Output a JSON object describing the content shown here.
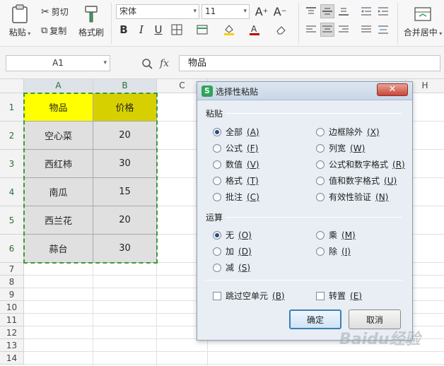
{
  "ribbon": {
    "paste_label": "粘贴",
    "cut_label": "剪切",
    "copy_label": "复制",
    "format_painter_label": "格式刷",
    "font_name": "宋体",
    "font_size": "11",
    "merge_center_label": "合并居中",
    "font_color": "#c00000",
    "fill_color": "#ffcc00"
  },
  "formula_bar": {
    "name_box": "A1",
    "fx_label": "fx",
    "content": "物品"
  },
  "sheet": {
    "columns": [
      "A",
      "B",
      "C",
      "",
      "",
      "",
      "",
      "H"
    ],
    "rows": [
      "1",
      "2",
      "3",
      "4",
      "5",
      "6",
      "7",
      "8",
      "9",
      "10",
      "11",
      "12",
      "13",
      "14"
    ],
    "data": [
      [
        "物品",
        "价格"
      ],
      [
        "空心菜",
        "20"
      ],
      [
        "西红柿",
        "30"
      ],
      [
        "南瓜",
        "15"
      ],
      [
        "西兰花",
        "20"
      ],
      [
        "蒜台",
        "30"
      ]
    ]
  },
  "dialog": {
    "title": "选择性粘贴",
    "paste_group": "粘贴",
    "paste_options": [
      {
        "label": "全部",
        "key": "(A)",
        "selected": true
      },
      {
        "label": "公式",
        "key": "(F)",
        "selected": false
      },
      {
        "label": "数值",
        "key": "(V)",
        "selected": false
      },
      {
        "label": "格式",
        "key": "(T)",
        "selected": false
      },
      {
        "label": "批注",
        "key": "(C)",
        "selected": false
      },
      {
        "label": "边框除外",
        "key": "(X)",
        "selected": false
      },
      {
        "label": "列宽",
        "key": "(W)",
        "selected": false
      },
      {
        "label": "公式和数字格式",
        "key": "(R)",
        "selected": false
      },
      {
        "label": "值和数字格式",
        "key": "(U)",
        "selected": false
      },
      {
        "label": "有效性验证",
        "key": "(N)",
        "selected": false
      }
    ],
    "operation_group": "运算",
    "operation_options": [
      {
        "label": "无",
        "key": "(O)",
        "selected": true
      },
      {
        "label": "加",
        "key": "(D)",
        "selected": false
      },
      {
        "label": "减",
        "key": "(S)",
        "selected": false
      },
      {
        "label": "乘",
        "key": "(M)",
        "selected": false
      },
      {
        "label": "除",
        "key": "(I)",
        "selected": false
      }
    ],
    "skip_blanks": {
      "label": "跳过空单元",
      "key": "(B)"
    },
    "transpose": {
      "label": "转置",
      "key": "(E)"
    },
    "ok_label": "确定",
    "cancel_label": "取消"
  },
  "watermark": "Baidu经验"
}
